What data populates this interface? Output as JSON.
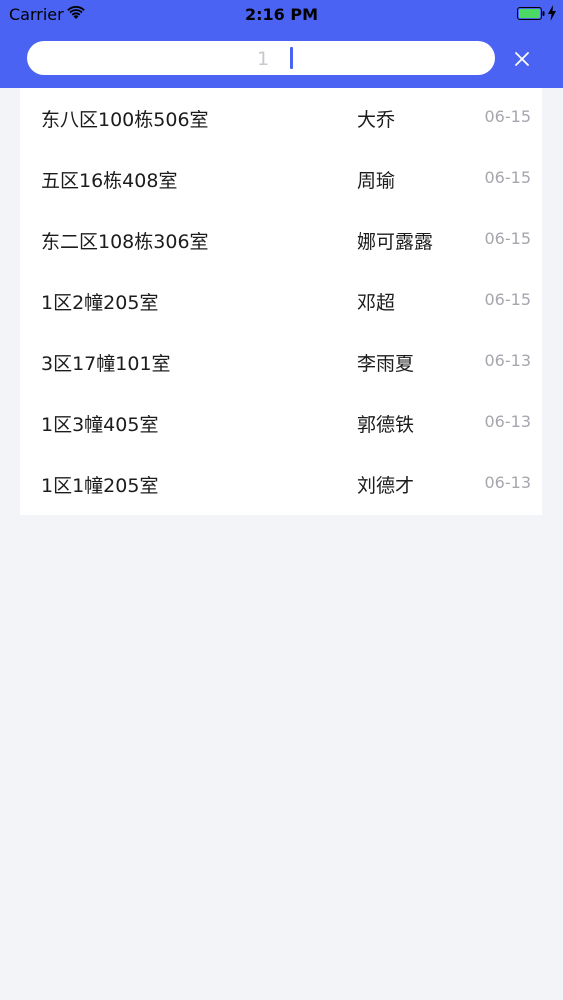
{
  "status_bar": {
    "carrier": "Carrier",
    "time": "2:16 PM"
  },
  "search": {
    "value": "1",
    "placeholder": ""
  },
  "records": [
    {
      "address": "东八区100栋506室",
      "name": "大乔",
      "date": "06-15"
    },
    {
      "address": "五区16栋408室",
      "name": "周瑜",
      "date": "06-15"
    },
    {
      "address": "东二区108栋306室",
      "name": "娜可露露",
      "date": "06-15"
    },
    {
      "address": "1区2幢205室",
      "name": "邓超",
      "date": "06-15"
    },
    {
      "address": "3区17幢101室",
      "name": "李雨夏",
      "date": "06-13"
    },
    {
      "address": "1区3幢405室",
      "name": "郭德铁",
      "date": "06-13"
    },
    {
      "address": "1区1幢205室",
      "name": "刘德才",
      "date": "06-13"
    }
  ],
  "colors": {
    "header": "#4a63f2",
    "background": "#f3f4f8",
    "battery": "#4cd964"
  },
  "icons": {
    "wifi": "wifi-icon",
    "battery": "battery-icon",
    "charging": "charging-bolt-icon",
    "close": "close-icon"
  }
}
